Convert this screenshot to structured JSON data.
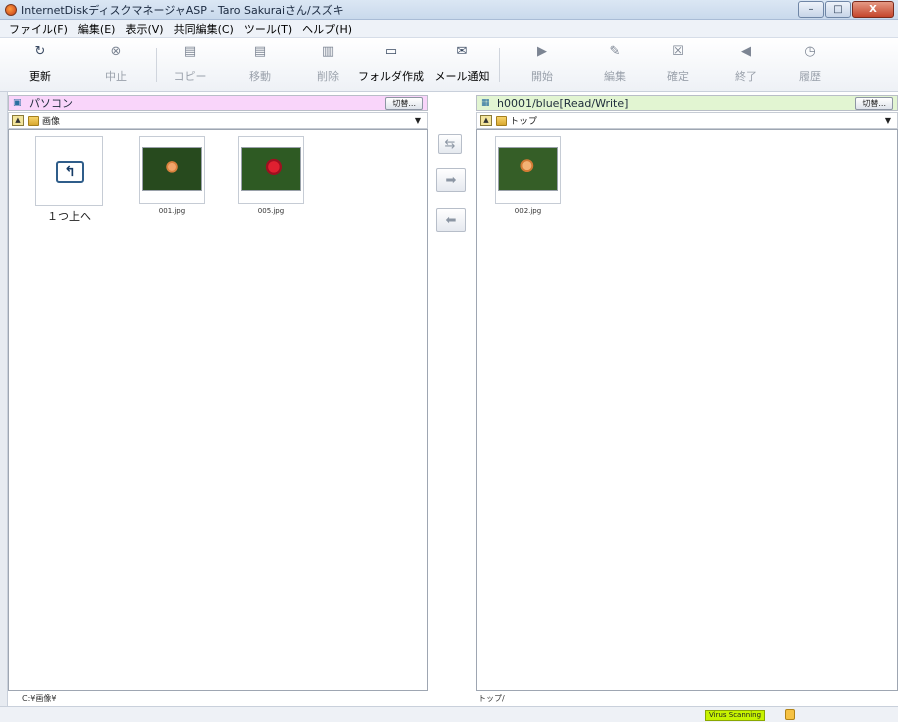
{
  "window": {
    "title": "InternetDiskディスクマネージャASP - Taro Sakuraiさん/スズキ",
    "controls": {
      "minimize": "–",
      "maximize": "□",
      "close": "X"
    }
  },
  "menubar": {
    "items": [
      "ファイル(F)",
      "編集(E)",
      "表示(V)",
      "共同編集(C)",
      "ツール(T)",
      "ヘルプ(H)"
    ]
  },
  "toolbar": {
    "buttons": [
      {
        "label": "更新",
        "icon": "refresh-icon",
        "enabled": true
      },
      {
        "label": "中止",
        "icon": "stop-icon",
        "enabled": false
      },
      {
        "label": "コピー",
        "icon": "copy-icon",
        "enabled": false
      },
      {
        "label": "移動",
        "icon": "move-icon",
        "enabled": false
      },
      {
        "label": "削除",
        "icon": "trash-icon",
        "enabled": false
      },
      {
        "label": "フォルダ作成",
        "icon": "new-folder-icon",
        "enabled": true
      },
      {
        "label": "メール通知",
        "icon": "mail-notify-icon",
        "enabled": true
      },
      {
        "label": "開始",
        "icon": "start-icon",
        "enabled": false
      },
      {
        "label": "編集",
        "icon": "edit-icon",
        "enabled": false
      },
      {
        "label": "確定",
        "icon": "confirm-icon",
        "enabled": false
      },
      {
        "label": "終了",
        "icon": "end-icon",
        "enabled": false
      },
      {
        "label": "履歴",
        "icon": "history-icon",
        "enabled": false
      }
    ]
  },
  "left_panel": {
    "title": "パソコン",
    "switch_label": "切替...",
    "path": "画像",
    "up_label": "１つ上へ",
    "files": [
      "001.jpg",
      "005.jpg"
    ],
    "footer_path": "C:¥画像¥"
  },
  "right_panel": {
    "title": "h0001/blue[Read/Write]",
    "switch_label": "切替...",
    "path": "トップ",
    "files": [
      "002.jpg"
    ],
    "footer_path": "トップ/"
  },
  "statusbar": {
    "virus_scanning": "Virus Scanning"
  },
  "colors": {
    "left_header_bg": "#f9d5fa",
    "right_header_bg": "#e2f5d2",
    "virus_badge_bg": "#c7f300"
  }
}
